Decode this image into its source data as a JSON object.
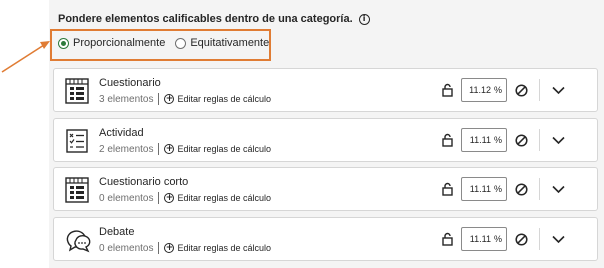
{
  "settings": {
    "heading": "Pondere elementos calificables dentro de una categoría.",
    "info_icon": "info-circle-icon",
    "options": [
      {
        "label": "Proporcionalmente",
        "selected": true
      },
      {
        "label": "Equitativamente",
        "selected": false
      }
    ]
  },
  "colors": {
    "highlight": "#e07c34",
    "radio_selected": "#2d7a3b",
    "panel_bg": "#f4f4f4"
  },
  "rules_link_label": "Editar reglas de cálculo",
  "percent_symbol": "%",
  "categories": [
    {
      "title": "Cuestionario",
      "count": "3 elementos",
      "percent": "11.12",
      "icon": "test-grid-icon"
    },
    {
      "title": "Actividad",
      "count": "2 elementos",
      "percent": "11.11",
      "icon": "checklist-icon"
    },
    {
      "title": "Cuestionario corto",
      "count": "0 elementos",
      "percent": "11.11",
      "icon": "test-grid-icon"
    },
    {
      "title": "Debate",
      "count": "0 elementos",
      "percent": "11.11",
      "icon": "discussion-bubbles-icon"
    }
  ]
}
